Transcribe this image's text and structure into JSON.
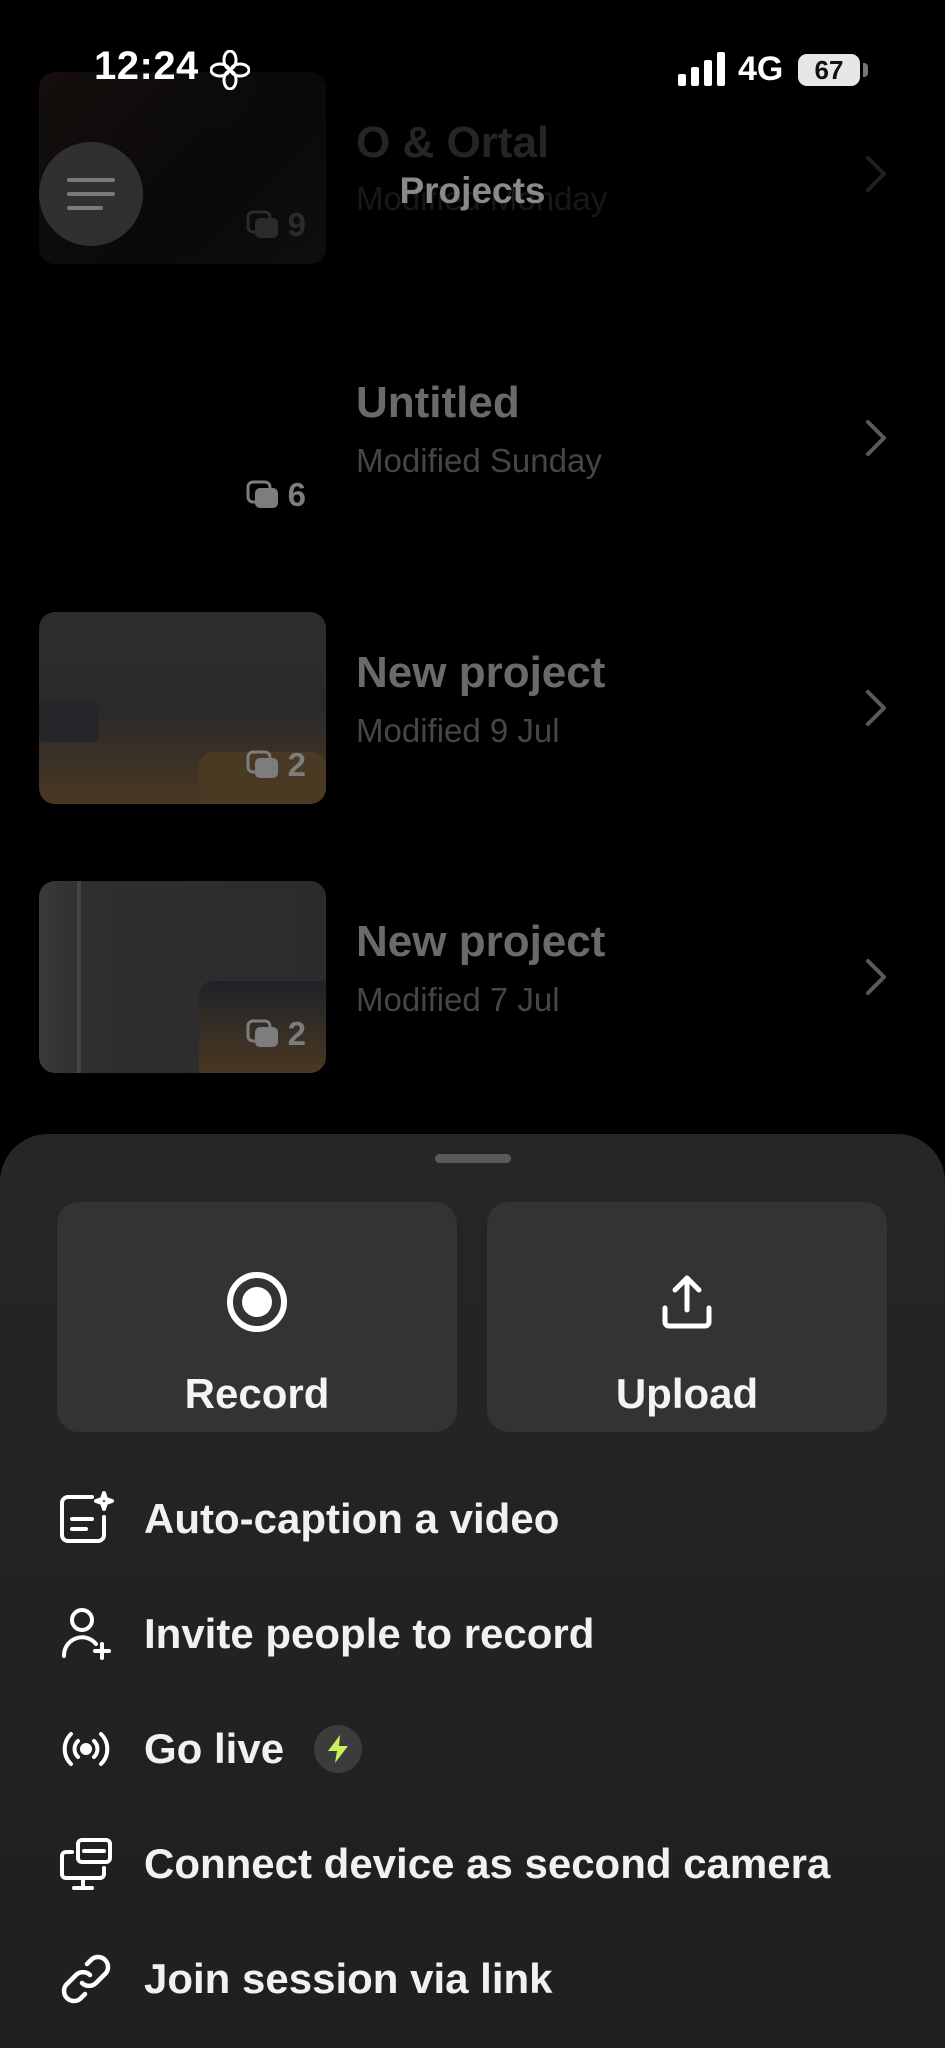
{
  "status_bar": {
    "time": "12:24",
    "network": "4G",
    "battery": "67"
  },
  "header": {
    "title": "Projects",
    "menu_icon": "hamburger-icon"
  },
  "projects": [
    {
      "title": "O & Ortal",
      "subtitle": "Modified Monday",
      "clips": "9",
      "thumb": "video"
    },
    {
      "title": "Untitled",
      "subtitle": "Modified Sunday",
      "clips": "6",
      "thumb": "none"
    },
    {
      "title": "New project",
      "subtitle": "Modified 9 Jul",
      "clips": "2",
      "thumb": "room"
    },
    {
      "title": "New project",
      "subtitle": "Modified 7 Jul",
      "clips": "2",
      "thumb": "wall"
    }
  ],
  "sheet": {
    "record_label": "Record",
    "upload_label": "Upload",
    "items": [
      {
        "label": "Auto-caption a video",
        "icon": "caption-sparkle-icon"
      },
      {
        "label": "Invite people to record",
        "icon": "add-person-icon"
      },
      {
        "label": "Go live",
        "icon": "broadcast-icon",
        "badge": "bolt-icon"
      },
      {
        "label": "Connect device as second camera",
        "icon": "second-screen-icon"
      },
      {
        "label": "Join session via link",
        "icon": "link-icon"
      }
    ]
  },
  "colors": {
    "sheet_bg": "#262626",
    "button_bg": "#333333",
    "bolt": "#c8f25a"
  }
}
